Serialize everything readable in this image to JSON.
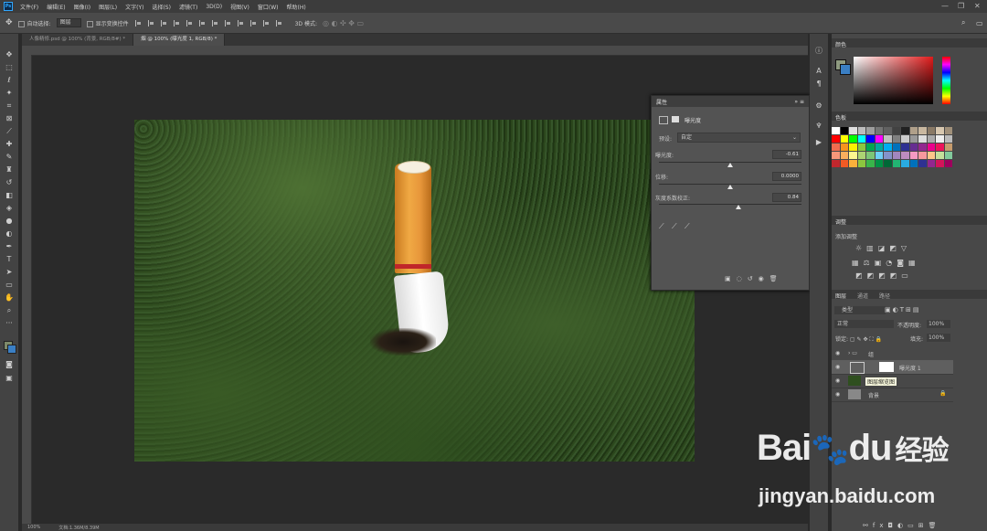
{
  "menubar": {
    "items": [
      "文件(F)",
      "编辑(E)",
      "图像(I)",
      "图层(L)",
      "文字(Y)",
      "选择(S)",
      "滤镜(T)",
      "3D(D)",
      "视图(V)",
      "窗口(W)",
      "帮助(H)"
    ],
    "logo": "Ps"
  },
  "options": {
    "auto_select": "自动选择:",
    "layer_select": "图层",
    "show_transform": "显示变换控件",
    "mode3d": "3D 模式:"
  },
  "tabs": [
    "人像精修.psd @ 100% (背景, RGB/8#) *",
    "烟 @ 100% (曝光度 1, RGB/8) *"
  ],
  "status": {
    "zoom": "100%",
    "doc": "文档:1.36M/8.39M"
  },
  "properties": {
    "title": "属性",
    "subtitle": "曝光度",
    "preset_label": "预设:",
    "preset_value": "自定",
    "exposure_label": "曝光度:",
    "exposure_value": "-0.61",
    "offset_label": "位移:",
    "offset_value": "0.0000",
    "gamma_label": "灰度系数校正:",
    "gamma_value": "0.84",
    "exposure_pos": 0.5,
    "offset_pos": 0.5,
    "gamma_pos": 0.56
  },
  "color_panel": {
    "tab": "颜色"
  },
  "swatches_panel": {
    "tab": "色板"
  },
  "adjust_panel": {
    "tab": "调整",
    "title": "添加调整"
  },
  "layers_panel": {
    "tabs": [
      "图层",
      "通道",
      "路径"
    ],
    "kind": "类型",
    "blend": "正常",
    "opacity_label": "不透明度:",
    "opacity": "100%",
    "fill_label": "填充:",
    "fill": "100%",
    "layers": [
      {
        "name": "组",
        "type": "group"
      },
      {
        "name": "曝光度 1",
        "type": "adjustment"
      },
      {
        "name": "",
        "type": "image",
        "tooltip": "图层缩览图"
      },
      {
        "name": "背景",
        "type": "background"
      }
    ]
  },
  "watermark": {
    "brand": "Bai",
    "brand2": "du",
    "cn": "经验",
    "url": "jingyan.baidu.com"
  }
}
